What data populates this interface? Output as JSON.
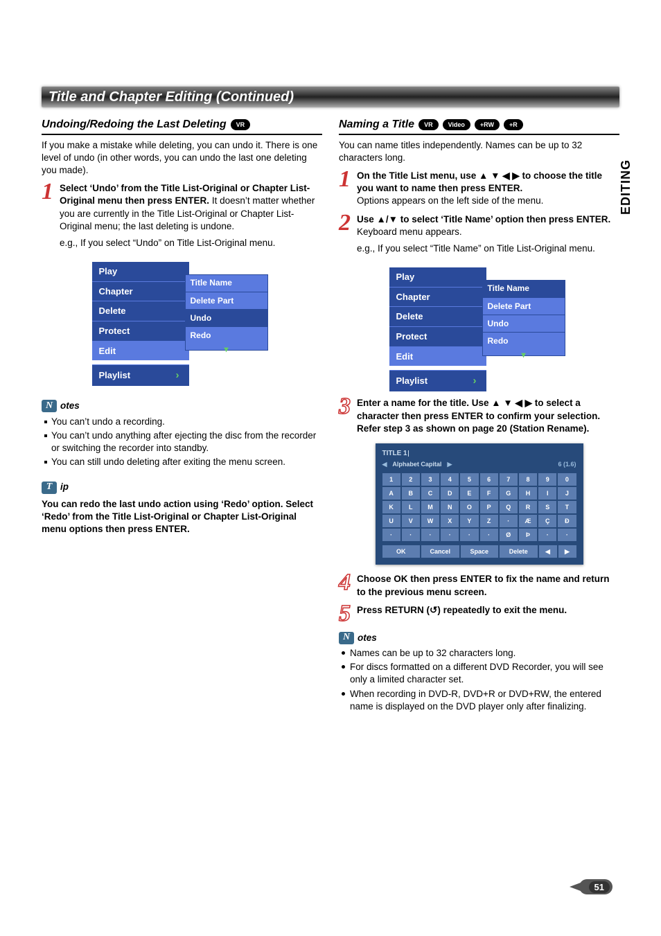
{
  "sidetab": "EDITING",
  "page_title": "Title and Chapter Editing (Continued)",
  "page_number": "51",
  "left": {
    "heading": "Undoing/Redoing the Last Deleting",
    "badges": [
      "VR"
    ],
    "intro": "If you make a mistake while deleting, you can undo it. There is one level of undo (in other words, you can undo the last one deleting you made).",
    "step1_bold": "Select ‘Undo’ from the Title List-Original or Chapter List-Original menu then press ENTER.",
    "step1_body": "It doesn’t matter whether you are currently in the Title List-Original or Chapter List-Original menu; the last deleting is undone.",
    "step1_eg": "e.g., If you select “Undo” on Title List-Original menu.",
    "menu": {
      "items": [
        "Play",
        "Chapter",
        "Delete",
        "Protect",
        "Edit"
      ],
      "playlist": "Playlist",
      "sub": [
        "Title Name",
        "Delete Part",
        "Undo",
        "Redo"
      ],
      "sub_selected": "Undo"
    },
    "notes_label": "otes",
    "notes": [
      "You can’t undo a recording.",
      "You can’t undo anything after ejecting the disc from the recorder or switching the recorder into standby.",
      "You can still undo deleting after exiting the menu screen."
    ],
    "tip_label": "ip",
    "tip_body": "You can redo the last undo action using ‘Redo’ option. Select ‘Redo’ from the Title List-Original or Chapter List-Original menu options then press ENTER."
  },
  "right": {
    "heading": "Naming a Title",
    "badges": [
      "VR",
      "Video",
      "+RW",
      "+R"
    ],
    "intro": "You can name titles independently. Names can be up to 32 characters long.",
    "step1_bold": "On the Title List menu, use ▲ ▼ ◀ ▶ to choose the title you want to name then press ENTER.",
    "step1_body": "Options appears on the left side of the menu.",
    "step2_bold": "Use ▲/▼ to select ‘Title Name’ option then press ENTER.",
    "step2_body": "Keyboard menu appears.",
    "step2_eg": "e.g., If you select “Title Name” on Title List-Original menu.",
    "menu": {
      "items": [
        "Play",
        "Chapter",
        "Delete",
        "Protect",
        "Edit"
      ],
      "playlist": "Playlist",
      "sub": [
        "Title Name",
        "Delete Part",
        "Undo",
        "Redo"
      ],
      "sub_selected": "Title Name"
    },
    "step3_bold": "Enter a name for the title. Use ▲ ▼ ◀ ▶ to select a character then press ENTER to confirm your selection. Refer step 3 as shown on page 20 (Station Rename).",
    "keyboard": {
      "title_field": "TITLE 1",
      "mode": "Alphabet Capital",
      "counter": "6 (1.6)",
      "row1": [
        "1",
        "2",
        "3",
        "4",
        "5",
        "6",
        "7",
        "8",
        "9",
        "0"
      ],
      "row2": [
        "A",
        "B",
        "C",
        "D",
        "E",
        "F",
        "G",
        "H",
        "I",
        "J"
      ],
      "row3": [
        "K",
        "L",
        "M",
        "N",
        "O",
        "P",
        "Q",
        "R",
        "S",
        "T"
      ],
      "row4": [
        "U",
        "V",
        "W",
        "X",
        "Y",
        "Z",
        "·",
        "Æ",
        "Ç",
        "Ð"
      ],
      "row5": [
        "·",
        "·",
        "·",
        "·",
        "·",
        "·",
        "Ø",
        "Þ",
        "·",
        "·"
      ],
      "bottom": [
        "OK",
        "Cancel",
        "Space",
        "Delete",
        "◀",
        "▶"
      ]
    },
    "step4_bold": "Choose OK then press ENTER to fix the name and return to the previous menu screen.",
    "step5_bold": "Press RETURN (↺) repeatedly to exit the menu.",
    "notes_label": "otes",
    "notes": [
      "Names can be up to 32 characters long.",
      "For discs formatted on a different DVD Recorder, you will see only a limited character set.",
      "When recording in DVD-R, DVD+R or DVD+RW, the entered name is displayed on the DVD player only after finalizing."
    ]
  }
}
